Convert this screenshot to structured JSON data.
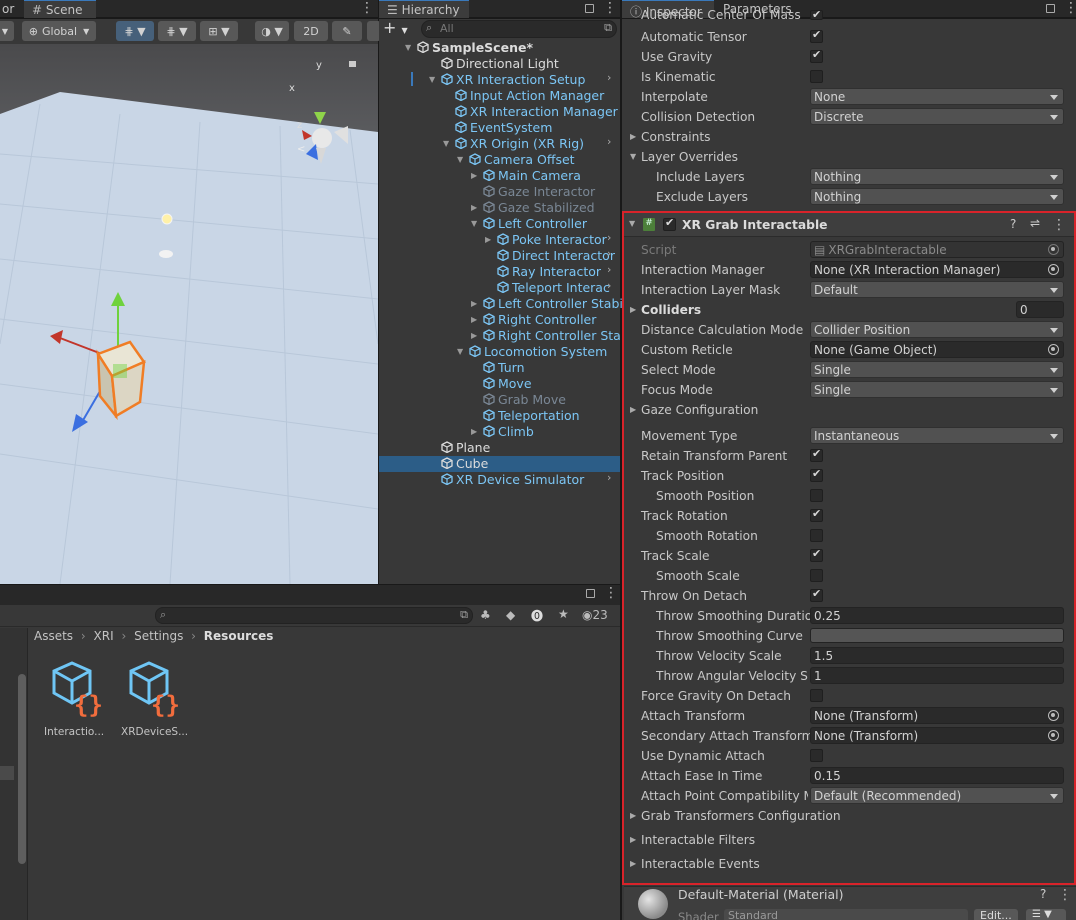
{
  "scene_tabs": {
    "partial_tab": "or",
    "scene_tab": "Scene"
  },
  "scene_toolbar": {
    "pivot_mode": "Global",
    "mode_2d": "2D"
  },
  "hierarchy": {
    "tab": "Hierarchy",
    "search_placeholder": "All",
    "items": [
      {
        "label": "SampleScene*",
        "style": "white"
      },
      {
        "label": "Directional Light",
        "style": "white"
      },
      {
        "label": "XR Interaction Setup",
        "style": "blue"
      },
      {
        "label": "Input Action Manager",
        "style": "blue"
      },
      {
        "label": "XR Interaction Manager",
        "style": "blue"
      },
      {
        "label": "EventSystem",
        "style": "blue"
      },
      {
        "label": "XR Origin (XR Rig)",
        "style": "blue"
      },
      {
        "label": "Camera Offset",
        "style": "blue"
      },
      {
        "label": "Main Camera",
        "style": "blue"
      },
      {
        "label": "Gaze Interactor",
        "style": "dim"
      },
      {
        "label": "Gaze Stabilized",
        "style": "dim"
      },
      {
        "label": "Left Controller",
        "style": "blue"
      },
      {
        "label": "Poke Interactor",
        "style": "blue"
      },
      {
        "label": "Direct Interactor",
        "style": "blue"
      },
      {
        "label": "Ray Interactor",
        "style": "blue"
      },
      {
        "label": "Teleport Interac",
        "style": "blue"
      },
      {
        "label": "Left Controller Stabiliz",
        "style": "blue"
      },
      {
        "label": "Right Controller",
        "style": "blue"
      },
      {
        "label": "Right Controller Stabi",
        "style": "blue"
      },
      {
        "label": "Locomotion System",
        "style": "blue"
      },
      {
        "label": "Turn",
        "style": "blue"
      },
      {
        "label": "Move",
        "style": "blue"
      },
      {
        "label": "Grab Move",
        "style": "dim"
      },
      {
        "label": "Teleportation",
        "style": "blue"
      },
      {
        "label": "Climb",
        "style": "blue"
      },
      {
        "label": "Plane",
        "style": "white"
      },
      {
        "label": "Cube",
        "style": "white"
      },
      {
        "label": "XR Device Simulator",
        "style": "blue"
      }
    ]
  },
  "project": {
    "breadcrumb": [
      "Assets",
      "XRI",
      "Settings",
      "Resources"
    ],
    "count": "23",
    "assets": [
      "Interactio...",
      "XRDeviceS..."
    ]
  },
  "inspector": {
    "tab": "Inspector",
    "tab2": "Parameters",
    "rigidbody": {
      "cut_row": "Automatic Center Of Mass",
      "automatic_tensor": "Automatic Tensor",
      "use_gravity": "Use Gravity",
      "is_kinematic": "Is Kinematic",
      "interpolate": "Interpolate",
      "interpolate_value": "None",
      "collision_detection": "Collision Detection",
      "collision_detection_value": "Discrete",
      "constraints": "Constraints",
      "layer_overrides": "Layer Overrides",
      "include_layers": "Include Layers",
      "include_layers_value": "Nothing",
      "exclude_layers": "Exclude Layers",
      "exclude_layers_value": "Nothing"
    },
    "grab": {
      "title": "XR Grab Interactable",
      "script": "Script",
      "script_value": "XRGrabInteractable",
      "interaction_manager": "Interaction Manager",
      "interaction_manager_value": "None (XR Interaction Manager)",
      "interaction_layer_mask": "Interaction Layer Mask",
      "interaction_layer_mask_value": "Default",
      "colliders": "Colliders",
      "colliders_value": "0",
      "distance_calc": "Distance Calculation Mode",
      "distance_calc_value": "Collider Position",
      "custom_reticle": "Custom Reticle",
      "custom_reticle_value": "None (Game Object)",
      "select_mode": "Select Mode",
      "select_mode_value": "Single",
      "focus_mode": "Focus Mode",
      "focus_mode_value": "Single",
      "gaze_config": "Gaze Configuration",
      "movement_type": "Movement Type",
      "movement_type_value": "Instantaneous",
      "retain_parent": "Retain Transform Parent",
      "track_position": "Track Position",
      "smooth_position": "Smooth Position",
      "track_rotation": "Track Rotation",
      "smooth_rotation": "Smooth Rotation",
      "track_scale": "Track Scale",
      "smooth_scale": "Smooth Scale",
      "throw_on_detach": "Throw On Detach",
      "throw_smoothing_duration": "Throw Smoothing Duration",
      "throw_smoothing_duration_value": "0.25",
      "throw_smoothing_curve": "Throw Smoothing Curve",
      "throw_velocity_scale": "Throw Velocity Scale",
      "throw_velocity_scale_value": "1.5",
      "throw_angular": "Throw Angular Velocity Sca",
      "throw_angular_value": "1",
      "force_gravity": "Force Gravity On Detach",
      "attach_transform": "Attach Transform",
      "attach_transform_value": "None (Transform)",
      "secondary_attach": "Secondary Attach Transform",
      "secondary_attach_value": "None (Transform)",
      "use_dynamic_attach": "Use Dynamic Attach",
      "attach_ease": "Attach Ease In Time",
      "attach_ease_value": "0.15",
      "attach_compat": "Attach Point Compatibility Mo",
      "attach_compat_value": "Default (Recommended)",
      "grab_transformers": "Grab Transformers Configuration",
      "interactable_filters": "Interactable Filters",
      "interactable_events": "Interactable Events"
    },
    "material": {
      "name": "Default-Material (Material)",
      "shader": "Shader",
      "shader_value": "Standard",
      "edit": "Edit..."
    }
  },
  "colors": {
    "highlight_border": "#d9232a",
    "selection": "#2c5d87",
    "accent_blue": "#7cc6f5"
  }
}
